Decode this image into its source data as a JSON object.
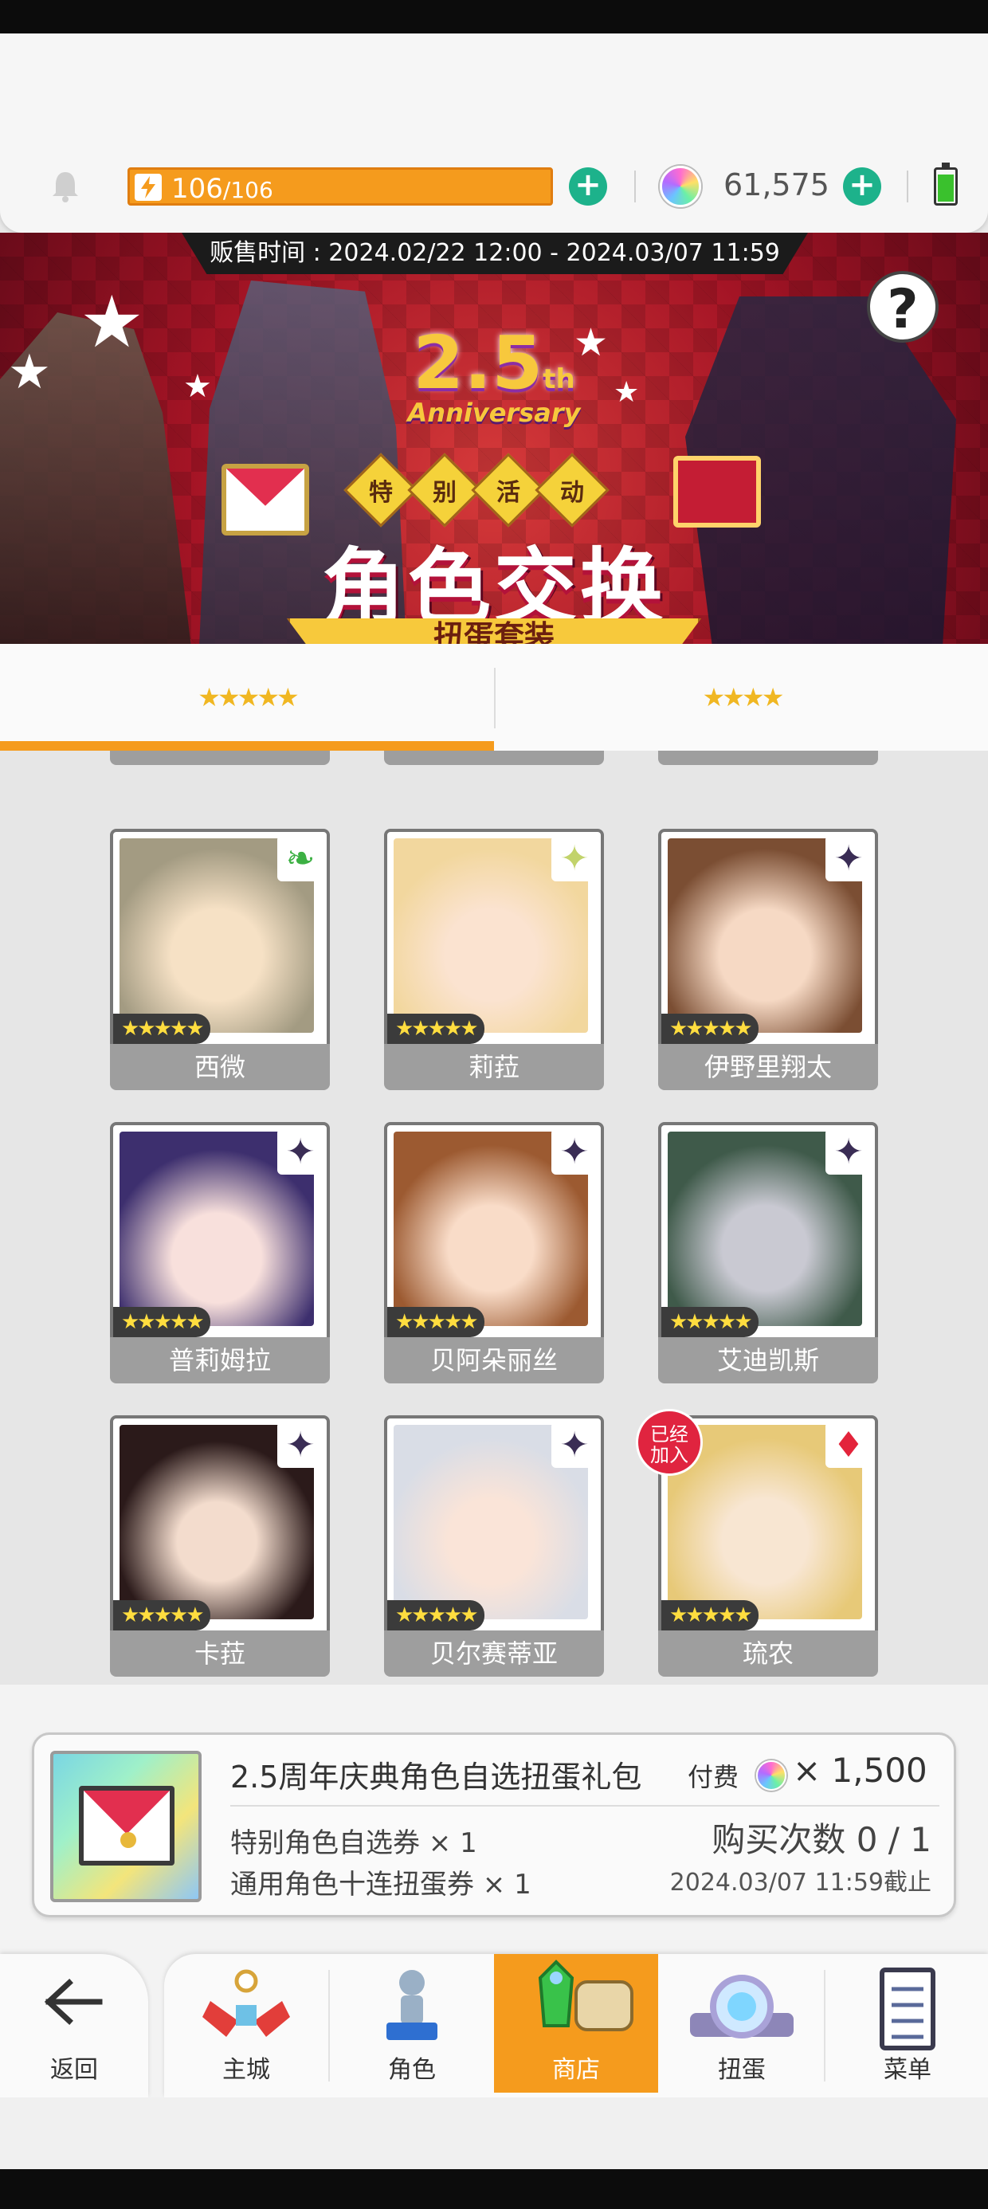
{
  "header": {
    "stamina_current": "106",
    "stamina_max": "/106",
    "gem_count": "61,575",
    "stamina_color": "#f59b1d",
    "plus_color": "#1db28b"
  },
  "banner": {
    "sale_time": "贩售时间 : 2024.02/22 12:00 - 2024.03/07 11:59",
    "anniversary_number": "2.5",
    "anniversary_suffix": "th",
    "anniversary_text": "Anniversary",
    "event_tags": [
      "特",
      "别",
      "活",
      "动"
    ],
    "title": "角色交换",
    "subtitle": "扭蛋套装",
    "help_label": "?"
  },
  "tabs": [
    {
      "label": "★★★★★",
      "active": true
    },
    {
      "label": "★★★★",
      "active": false
    }
  ],
  "characters": [
    {
      "name": "西微",
      "stars": "★★★★★",
      "element_icon": "wind-leaf-icon",
      "added": false
    },
    {
      "name": "莉菈",
      "stars": "★★★★★",
      "element_icon": "light-sparkle-icon",
      "added": false
    },
    {
      "name": "伊野里翔太",
      "stars": "★★★★★",
      "element_icon": "dark-sparkle-icon",
      "added": false
    },
    {
      "name": "普莉姆拉",
      "stars": "★★★★★",
      "element_icon": "dark-sparkle-icon",
      "added": false
    },
    {
      "name": "贝阿朵丽丝",
      "stars": "★★★★★",
      "element_icon": "dark-sparkle-icon",
      "added": false
    },
    {
      "name": "艾迪凯斯",
      "stars": "★★★★★",
      "element_icon": "dark-sparkle-icon",
      "added": false
    },
    {
      "name": "卡菈",
      "stars": "★★★★★",
      "element_icon": "dark-sparkle-icon",
      "added": false
    },
    {
      "name": "贝尔赛蒂亚",
      "stars": "★★★★★",
      "element_icon": "dark-sparkle-icon",
      "added": false
    },
    {
      "name": "琉农",
      "stars": "★★★★★",
      "element_icon": "fire-diamond-icon",
      "added": true
    }
  ],
  "added_badge": "已经\n加入",
  "peek_badge": "已经",
  "product": {
    "name": "2.5周年庆典角色自选扭蛋礼包",
    "pay_label": "付费",
    "price": "× 1,500",
    "items": [
      "特别角色自选券 × 1",
      "通用角色十连扭蛋券 × 1"
    ],
    "purchase_count": "购买次数 0 / 1",
    "deadline": "2024.03/07 11:59截止"
  },
  "nav": {
    "back": "返回",
    "items": [
      {
        "label": "主城",
        "icon": "castle-icon"
      },
      {
        "label": "角色",
        "icon": "character-statue-icon"
      },
      {
        "label": "商店",
        "icon": "shop-bag-icon",
        "active": true
      },
      {
        "label": "扭蛋",
        "icon": "gacha-orb-icon"
      },
      {
        "label": "菜单",
        "icon": "menu-list-icon"
      }
    ]
  }
}
